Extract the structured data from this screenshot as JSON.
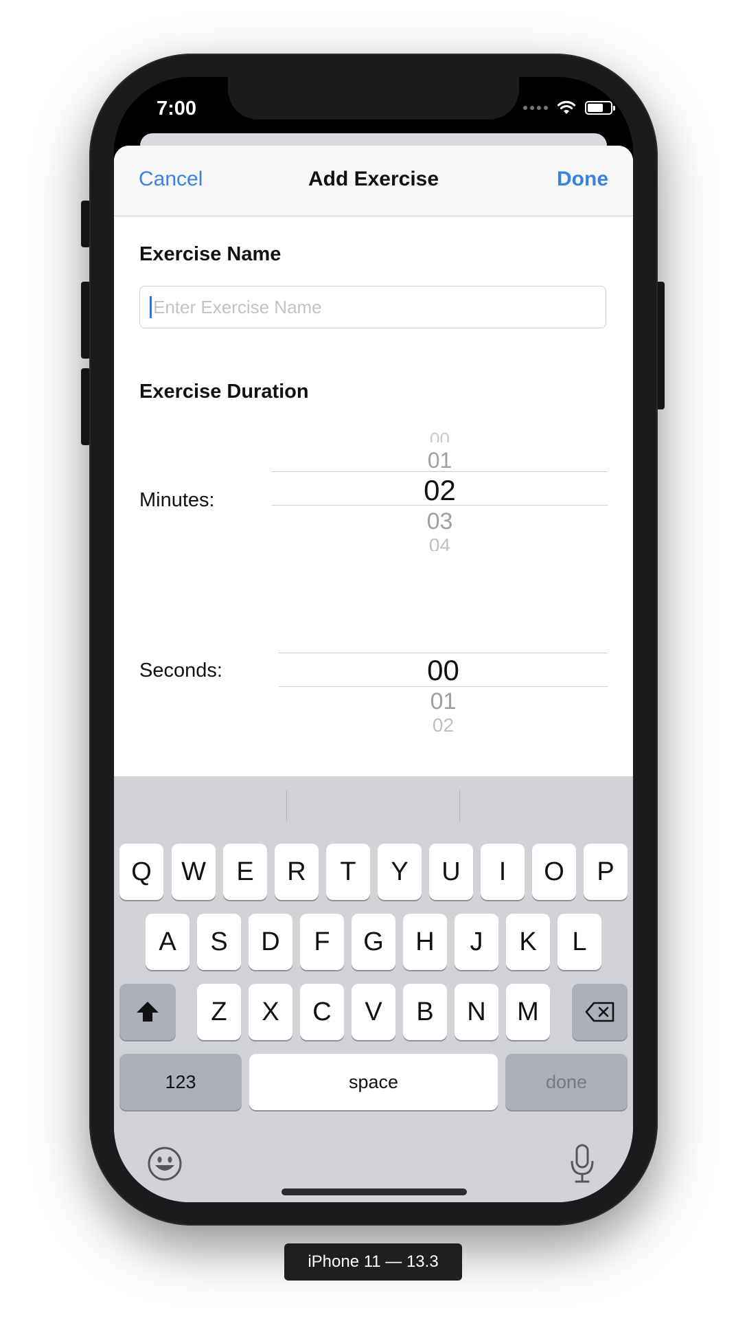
{
  "status_bar": {
    "time": "7:00"
  },
  "nav": {
    "cancel_label": "Cancel",
    "title": "Add Exercise",
    "done_label": "Done"
  },
  "form": {
    "exercise_name_label": "Exercise Name",
    "exercise_name_placeholder": "Enter Exercise Name",
    "exercise_name_value": "",
    "duration_label": "Exercise Duration",
    "minutes_label": "Minutes:",
    "seconds_label": "Seconds:",
    "minutes_picker": {
      "above": [
        "00",
        "01"
      ],
      "selected": "02",
      "below": [
        "03",
        "04"
      ]
    },
    "seconds_picker": {
      "selected": "00",
      "below": [
        "01",
        "02"
      ]
    }
  },
  "keyboard": {
    "row1": [
      "Q",
      "W",
      "E",
      "R",
      "T",
      "Y",
      "U",
      "I",
      "O",
      "P"
    ],
    "row2": [
      "A",
      "S",
      "D",
      "F",
      "G",
      "H",
      "J",
      "K",
      "L"
    ],
    "row3": [
      "Z",
      "X",
      "C",
      "V",
      "B",
      "N",
      "M"
    ],
    "numbers_label": "123",
    "space_label": "space",
    "done_label": "done"
  },
  "device_label": "iPhone 11 — 13.3",
  "colors": {
    "accent": "#3b82df",
    "keyboard_bg": "#d1d3d9"
  },
  "icons": [
    "wifi-icon",
    "battery-icon",
    "shift-icon",
    "backspace-icon",
    "emoji-icon",
    "microphone-icon"
  ]
}
